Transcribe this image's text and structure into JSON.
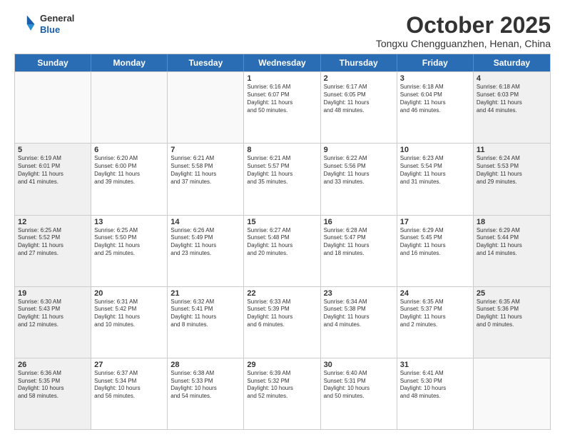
{
  "logo": {
    "general": "General",
    "blue": "Blue"
  },
  "title": "October 2025",
  "location": "Tongxu Chengguanzhen, Henan, China",
  "days": [
    "Sunday",
    "Monday",
    "Tuesday",
    "Wednesday",
    "Thursday",
    "Friday",
    "Saturday"
  ],
  "weeks": [
    [
      {
        "num": "",
        "text": ""
      },
      {
        "num": "",
        "text": ""
      },
      {
        "num": "",
        "text": ""
      },
      {
        "num": "1",
        "text": "Sunrise: 6:16 AM\nSunset: 6:07 PM\nDaylight: 11 hours\nand 50 minutes."
      },
      {
        "num": "2",
        "text": "Sunrise: 6:17 AM\nSunset: 6:05 PM\nDaylight: 11 hours\nand 48 minutes."
      },
      {
        "num": "3",
        "text": "Sunrise: 6:18 AM\nSunset: 6:04 PM\nDaylight: 11 hours\nand 46 minutes."
      },
      {
        "num": "4",
        "text": "Sunrise: 6:18 AM\nSunset: 6:03 PM\nDaylight: 11 hours\nand 44 minutes."
      }
    ],
    [
      {
        "num": "5",
        "text": "Sunrise: 6:19 AM\nSunset: 6:01 PM\nDaylight: 11 hours\nand 41 minutes."
      },
      {
        "num": "6",
        "text": "Sunrise: 6:20 AM\nSunset: 6:00 PM\nDaylight: 11 hours\nand 39 minutes."
      },
      {
        "num": "7",
        "text": "Sunrise: 6:21 AM\nSunset: 5:58 PM\nDaylight: 11 hours\nand 37 minutes."
      },
      {
        "num": "8",
        "text": "Sunrise: 6:21 AM\nSunset: 5:57 PM\nDaylight: 11 hours\nand 35 minutes."
      },
      {
        "num": "9",
        "text": "Sunrise: 6:22 AM\nSunset: 5:56 PM\nDaylight: 11 hours\nand 33 minutes."
      },
      {
        "num": "10",
        "text": "Sunrise: 6:23 AM\nSunset: 5:54 PM\nDaylight: 11 hours\nand 31 minutes."
      },
      {
        "num": "11",
        "text": "Sunrise: 6:24 AM\nSunset: 5:53 PM\nDaylight: 11 hours\nand 29 minutes."
      }
    ],
    [
      {
        "num": "12",
        "text": "Sunrise: 6:25 AM\nSunset: 5:52 PM\nDaylight: 11 hours\nand 27 minutes."
      },
      {
        "num": "13",
        "text": "Sunrise: 6:25 AM\nSunset: 5:50 PM\nDaylight: 11 hours\nand 25 minutes."
      },
      {
        "num": "14",
        "text": "Sunrise: 6:26 AM\nSunset: 5:49 PM\nDaylight: 11 hours\nand 23 minutes."
      },
      {
        "num": "15",
        "text": "Sunrise: 6:27 AM\nSunset: 5:48 PM\nDaylight: 11 hours\nand 20 minutes."
      },
      {
        "num": "16",
        "text": "Sunrise: 6:28 AM\nSunset: 5:47 PM\nDaylight: 11 hours\nand 18 minutes."
      },
      {
        "num": "17",
        "text": "Sunrise: 6:29 AM\nSunset: 5:45 PM\nDaylight: 11 hours\nand 16 minutes."
      },
      {
        "num": "18",
        "text": "Sunrise: 6:29 AM\nSunset: 5:44 PM\nDaylight: 11 hours\nand 14 minutes."
      }
    ],
    [
      {
        "num": "19",
        "text": "Sunrise: 6:30 AM\nSunset: 5:43 PM\nDaylight: 11 hours\nand 12 minutes."
      },
      {
        "num": "20",
        "text": "Sunrise: 6:31 AM\nSunset: 5:42 PM\nDaylight: 11 hours\nand 10 minutes."
      },
      {
        "num": "21",
        "text": "Sunrise: 6:32 AM\nSunset: 5:41 PM\nDaylight: 11 hours\nand 8 minutes."
      },
      {
        "num": "22",
        "text": "Sunrise: 6:33 AM\nSunset: 5:39 PM\nDaylight: 11 hours\nand 6 minutes."
      },
      {
        "num": "23",
        "text": "Sunrise: 6:34 AM\nSunset: 5:38 PM\nDaylight: 11 hours\nand 4 minutes."
      },
      {
        "num": "24",
        "text": "Sunrise: 6:35 AM\nSunset: 5:37 PM\nDaylight: 11 hours\nand 2 minutes."
      },
      {
        "num": "25",
        "text": "Sunrise: 6:35 AM\nSunset: 5:36 PM\nDaylight: 11 hours\nand 0 minutes."
      }
    ],
    [
      {
        "num": "26",
        "text": "Sunrise: 6:36 AM\nSunset: 5:35 PM\nDaylight: 10 hours\nand 58 minutes."
      },
      {
        "num": "27",
        "text": "Sunrise: 6:37 AM\nSunset: 5:34 PM\nDaylight: 10 hours\nand 56 minutes."
      },
      {
        "num": "28",
        "text": "Sunrise: 6:38 AM\nSunset: 5:33 PM\nDaylight: 10 hours\nand 54 minutes."
      },
      {
        "num": "29",
        "text": "Sunrise: 6:39 AM\nSunset: 5:32 PM\nDaylight: 10 hours\nand 52 minutes."
      },
      {
        "num": "30",
        "text": "Sunrise: 6:40 AM\nSunset: 5:31 PM\nDaylight: 10 hours\nand 50 minutes."
      },
      {
        "num": "31",
        "text": "Sunrise: 6:41 AM\nSunset: 5:30 PM\nDaylight: 10 hours\nand 48 minutes."
      },
      {
        "num": "",
        "text": ""
      }
    ]
  ]
}
